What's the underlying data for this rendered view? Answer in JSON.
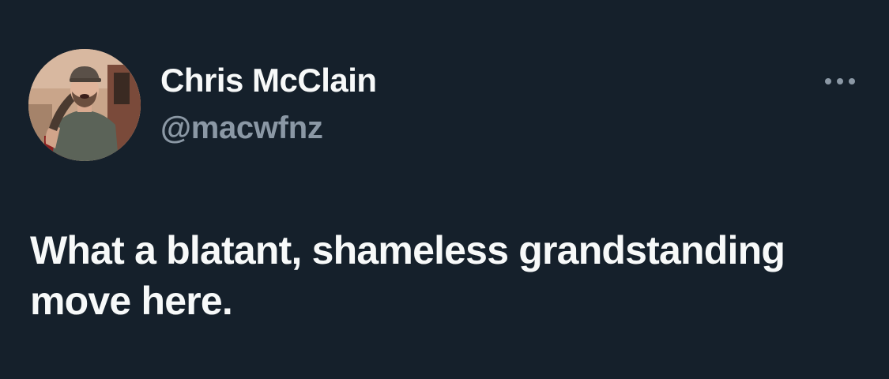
{
  "tweet": {
    "author": {
      "display_name": "Chris McClain",
      "handle": "@macwfnz",
      "avatar_icon": "profile-photo"
    },
    "more_icon": "more-horizontal-icon",
    "text": "What a blatant, shameless grandstanding move here."
  },
  "colors": {
    "background": "#15202b",
    "primary_text": "#f7f9f9",
    "secondary_text": "#8b98a5"
  }
}
